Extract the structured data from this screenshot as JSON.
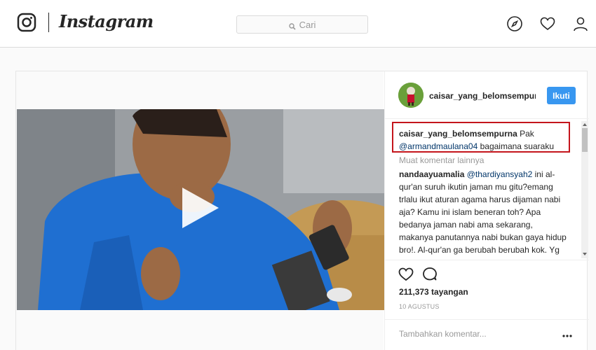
{
  "header": {
    "brand": "Instagram",
    "search_placeholder": "Cari"
  },
  "post": {
    "author": "caisar_yang_belomsempurna",
    "author_header": "caisar_yang_belomsempurr",
    "follow_label": "Ikuti",
    "caption": {
      "username": "caisar_yang_belomsempurna",
      "text_before": "Pak",
      "mention": "@armandmaulana04",
      "text_after": "bagaimana suaraku"
    },
    "load_more": "Muat komentar lainnya",
    "comments": [
      {
        "username": "nandaayuamalia",
        "mention": "@thardiyansyah2",
        "text": "ini al-qur'an suruh ikutin jaman mu gitu?emang trlalu ikut aturan agama harus dijaman nabi aja? Kamu ini islam beneran toh? Apa bedanya jaman nabi ama sekarang, makanya panutannya nabi bukan gaya hidup bro!. Al-qur'an ga berubah berubah kok. Yg dilarang dari dulu ampe skrg sama."
      }
    ],
    "views": "211,373 tayangan",
    "date": "10 AGUSTUS",
    "comment_placeholder": "Tambahkan komentar...",
    "icons": {
      "like": "heart-outline-icon",
      "comment": "speech-bubble-icon",
      "more": "ellipsis-icon",
      "play": "play-icon"
    }
  },
  "colors": {
    "accent": "#3897f0",
    "highlight_border": "#c4151c",
    "mention": "#003569",
    "muted": "#999999"
  }
}
